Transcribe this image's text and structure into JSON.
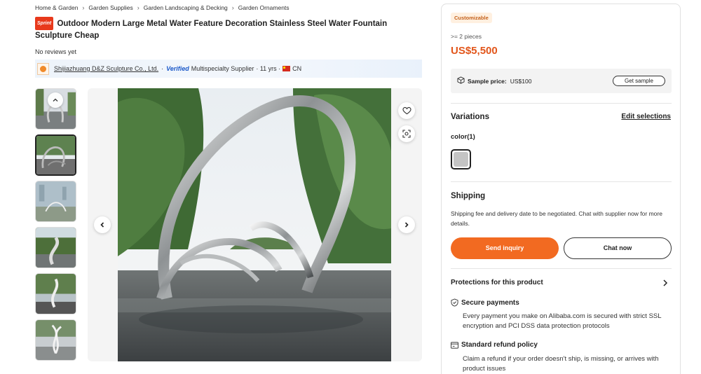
{
  "breadcrumb": [
    "Home & Garden",
    "Garden Supplies",
    "Garden Landscaping & Decking",
    "Garden Ornaments"
  ],
  "product": {
    "badge": "Sprint",
    "title": "Outdoor Modern Large Metal Water Feature Decoration Stainless Steel Water Fountain Sculpture Cheap",
    "reviews": "No reviews yet"
  },
  "supplier": {
    "name": "Shijiazhuang D&Z Sculpture Co., Ltd.",
    "sep1": "·",
    "verified": "Verified",
    "type": "Multispecialty Supplier",
    "years": "· 11 yrs ·",
    "country": "CN"
  },
  "gallery": {
    "thumb_count": 6,
    "active_index": 1
  },
  "purchase": {
    "customizable": "Customizable",
    "moq": ">= 2 pieces",
    "price": "US$5,500",
    "sample_label": "Sample price:",
    "sample_price": "US$100",
    "get_sample": "Get sample"
  },
  "variations": {
    "title": "Variations",
    "edit": "Edit selections",
    "color_label": "color(1)",
    "swatch_color": "#c4c4c4"
  },
  "shipping": {
    "title": "Shipping",
    "note": "Shipping fee and delivery date to be negotiated. Chat with supplier now for more details."
  },
  "actions": {
    "inquiry": "Send inquiry",
    "chat": "Chat now"
  },
  "protection": {
    "title": "Protections for this product",
    "secure_title": "Secure payments",
    "secure_text": "Every payment you make on Alibaba.com is secured with strict SSL encryption and PCI DSS data protection protocols",
    "refund_title": "Standard refund policy",
    "refund_text": "Claim a refund if your order doesn't ship, is missing, or arrives with product issues"
  },
  "colors": {
    "accent": "#f26a21",
    "price": "#e2561b",
    "badge": "#e8391c",
    "verified": "#1a58c9"
  }
}
